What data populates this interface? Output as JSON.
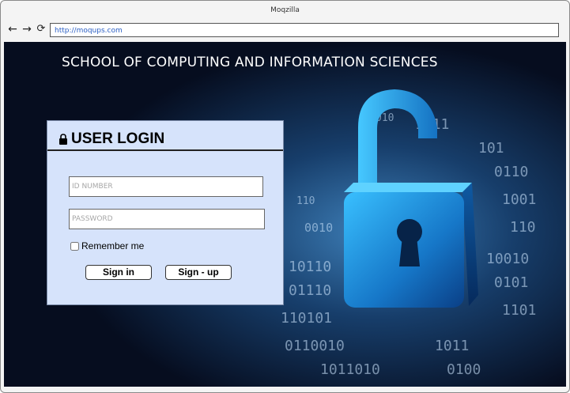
{
  "window": {
    "title": "Moqzilla"
  },
  "browser": {
    "url": "http://moqups.com",
    "back_icon": "arrow-left-icon",
    "forward_icon": "arrow-right-icon",
    "reload_icon": "reload-icon"
  },
  "page": {
    "heading": "SCHOOL OF COMPUTING AND INFORMATION SCIENCES",
    "background": "padlock-binary-code-image"
  },
  "login": {
    "title": "USER LOGIN",
    "title_icon": "lock-icon",
    "id_placeholder": "ID NUMBER",
    "password_placeholder": "PASSWORD",
    "remember_label": "Remember me",
    "signin_label": "Sign in",
    "signup_label": "Sign - up"
  },
  "colors": {
    "panel_bg": "#d6e3fb",
    "page_bg": "#071025",
    "lock_blue": "#1aa0e8",
    "url_text": "#2b5fc4"
  }
}
